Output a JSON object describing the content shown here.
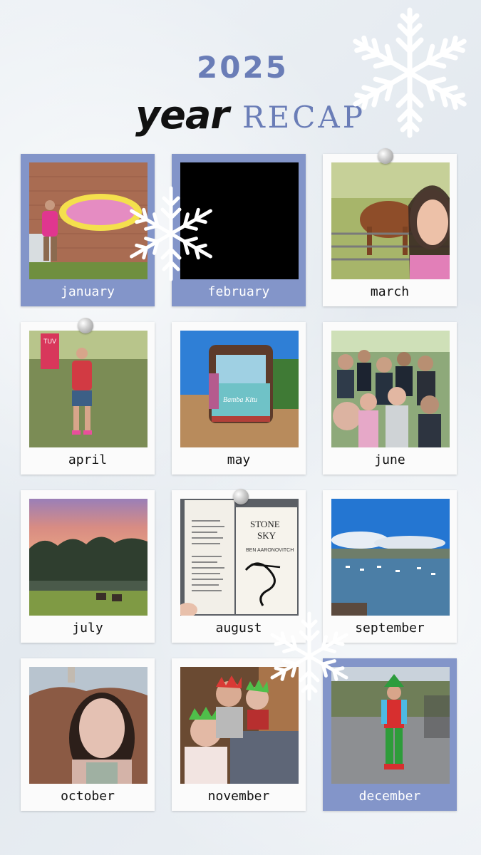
{
  "header": {
    "year": "2025",
    "title_word": "year",
    "title_recap": "RECAP"
  },
  "months": [
    {
      "label": "january",
      "frame": "blue"
    },
    {
      "label": "february",
      "frame": "blue"
    },
    {
      "label": "march",
      "frame": "white"
    },
    {
      "label": "april",
      "frame": "white"
    },
    {
      "label": "may",
      "frame": "white"
    },
    {
      "label": "june",
      "frame": "white"
    },
    {
      "label": "july",
      "frame": "white"
    },
    {
      "label": "august",
      "frame": "white"
    },
    {
      "label": "september",
      "frame": "white"
    },
    {
      "label": "october",
      "frame": "white"
    },
    {
      "label": "november",
      "frame": "white"
    },
    {
      "label": "december",
      "frame": "blue"
    }
  ],
  "april_photo": {
    "banner_text": "TUV"
  },
  "may_photo": {
    "sign_text": "Bamba Kitu"
  },
  "august_photo": {
    "book_title_line1": "STONE",
    "book_title_line2": "SKY",
    "book_author": "BEN AARONOVITCH"
  },
  "colors": {
    "accent": "#6a7db7",
    "frame_blue": "#8395c9",
    "background": "#e9eef3"
  }
}
